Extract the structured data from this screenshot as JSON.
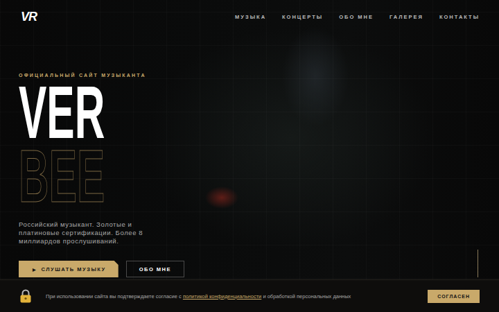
{
  "logo": "VR",
  "nav": [
    "МУЗЫКА",
    "КОНЦЕРТЫ",
    "ОБО МНЕ",
    "ГАЛЕРЕЯ",
    "КОНТАКТЫ"
  ],
  "hero": {
    "eyebrow": "ОФИЦИАЛЬНЫЙ САЙТ МУЗЫКАНТА",
    "title_top": "VER",
    "title_bottom": "BEE",
    "description": "Российский музыкант. Золотые и платиновые сертификации. Более 8 миллиардов прослушиваний.",
    "primary_button": {
      "icon": "▶",
      "label": "СЛУШАТЬ МУЗЫКУ"
    },
    "secondary_button": "ОБО МНЕ"
  },
  "cookie": {
    "text_before": "При использовании сайта вы подтверждаете согласие с ",
    "link": "политикой конфиденциальности",
    "text_after": " и обработкой персональных данных",
    "button": "СОГЛАСЕН"
  }
}
